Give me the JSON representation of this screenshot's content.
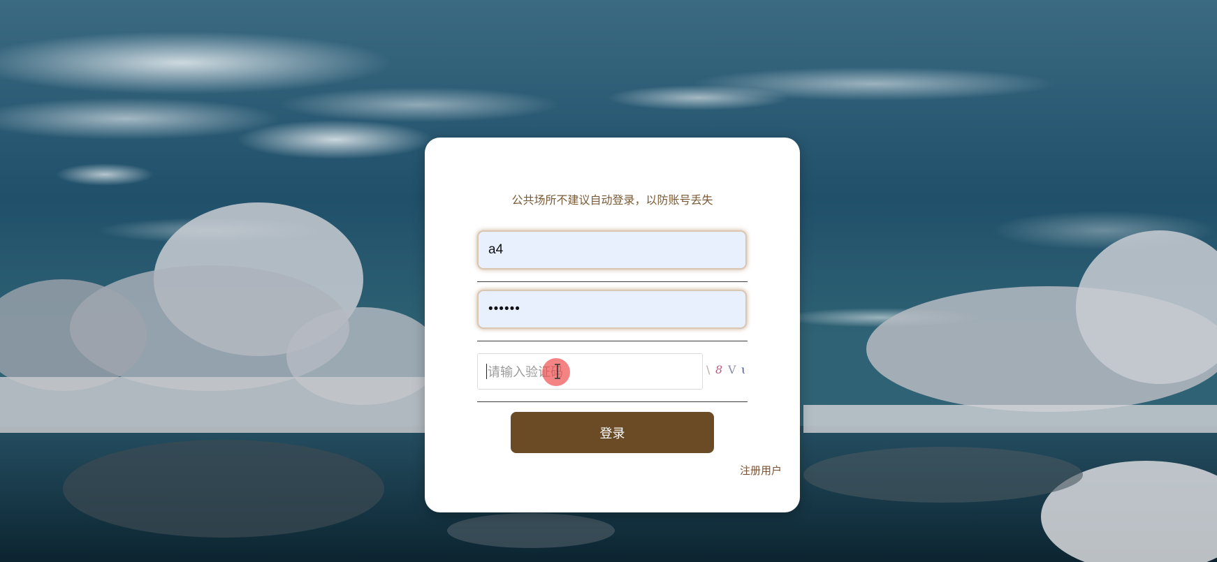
{
  "login": {
    "notice": "公共场所不建议自动登录，以防账号丢失",
    "username_value": "a4",
    "password_value": "••••••",
    "captcha_placeholder": "请输入验证码",
    "captcha_chars": [
      "\\",
      "8",
      "V",
      "ɩ"
    ],
    "login_button": "登录",
    "register_link": "注册用户"
  },
  "colors": {
    "accent": "#6b4a26",
    "notice_text": "#7a5a35",
    "field_fill": "#e8f0fe"
  },
  "icons": {
    "cursor": "text-cursor-icon"
  }
}
